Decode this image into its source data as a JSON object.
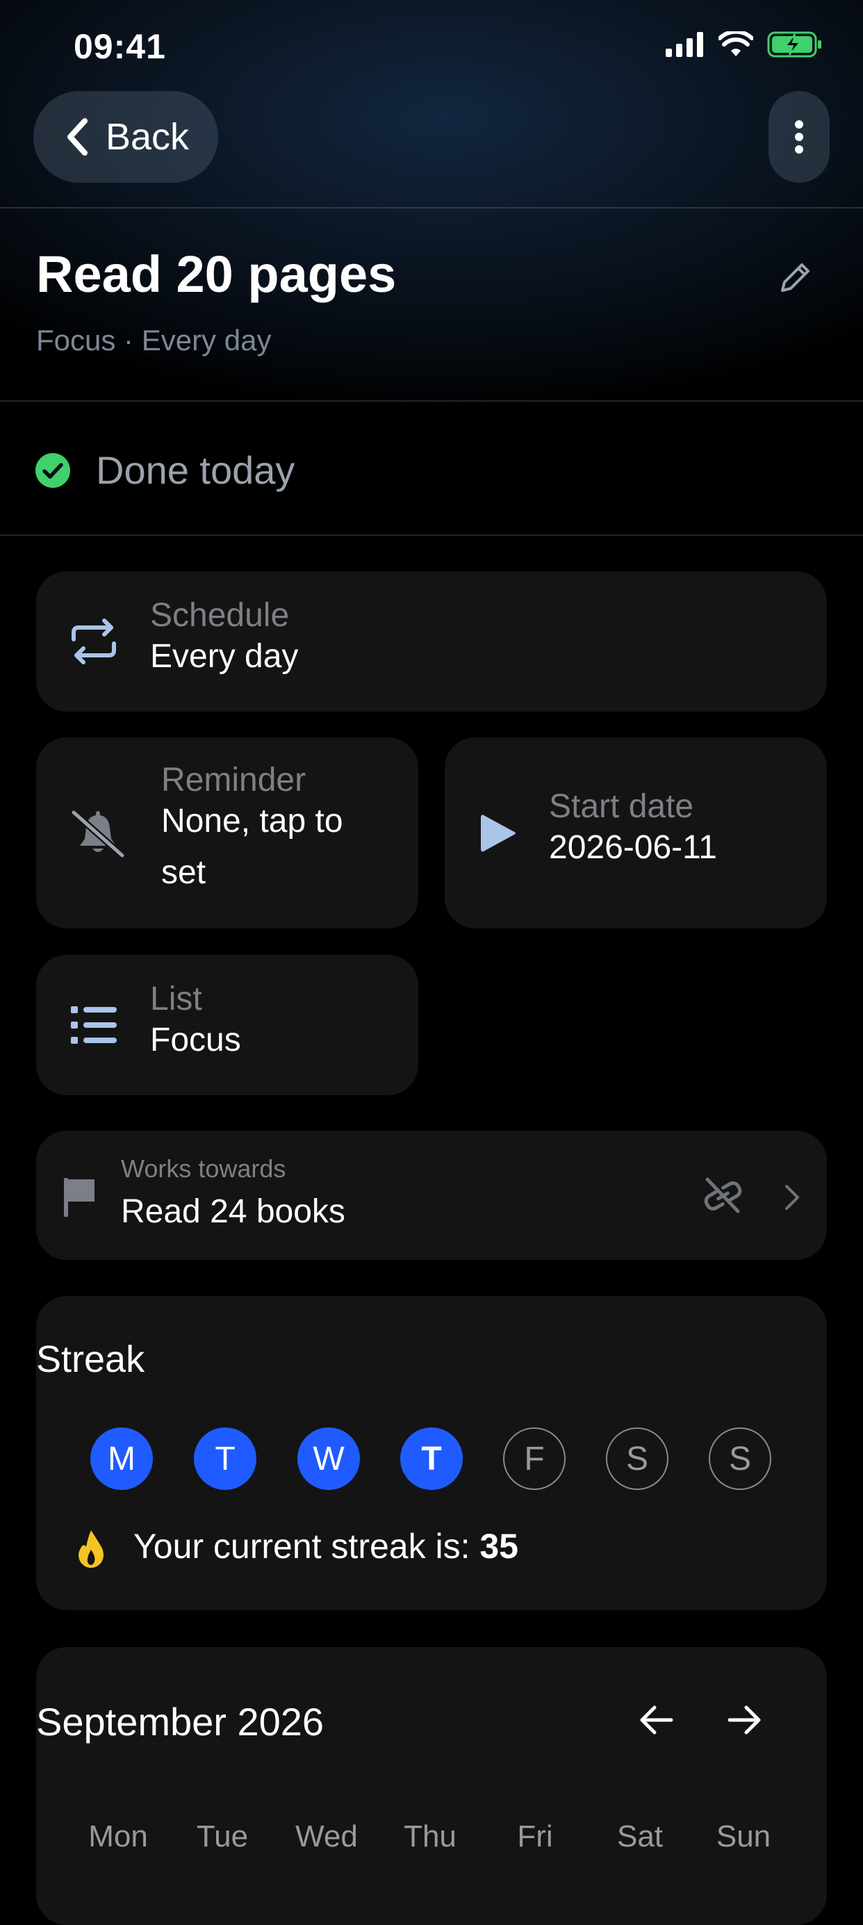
{
  "status_bar": {
    "time": "09:41"
  },
  "nav": {
    "back_label": "Back"
  },
  "header": {
    "title": "Read 20 pages",
    "subtitle": "Focus · Every day"
  },
  "done": {
    "label": "Done today",
    "color": "#3fd16b"
  },
  "schedule": {
    "label": "Schedule",
    "value": "Every day"
  },
  "reminder": {
    "label": "Reminder",
    "value": "None, tap to set"
  },
  "start_date": {
    "label": "Start date",
    "value": "2026-06-11"
  },
  "list": {
    "label": "List",
    "value": "Focus"
  },
  "goal": {
    "label": "Works towards",
    "value": "Read 24 books"
  },
  "streak": {
    "title": "Streak",
    "days": [
      {
        "letter": "M",
        "done": true
      },
      {
        "letter": "T",
        "done": true
      },
      {
        "letter": "W",
        "done": true
      },
      {
        "letter": "T",
        "done": true,
        "today": true
      },
      {
        "letter": "F",
        "done": false
      },
      {
        "letter": "S",
        "done": false
      },
      {
        "letter": "S",
        "done": false
      }
    ],
    "text_prefix": "Your current streak is: ",
    "count": "35",
    "accent": "#1f5bff"
  },
  "calendar": {
    "month": "September 2026",
    "weekdays": [
      "Mon",
      "Tue",
      "Wed",
      "Thu",
      "Fri",
      "Sat",
      "Sun"
    ]
  }
}
